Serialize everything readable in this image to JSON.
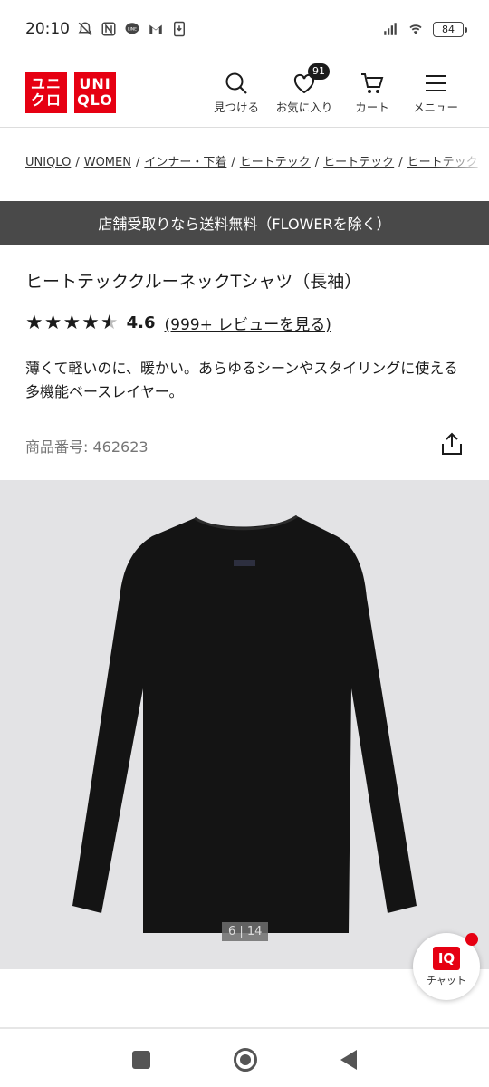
{
  "status_bar": {
    "time": "20:10",
    "battery": "84",
    "left_icons": [
      "mute-bell-icon",
      "nfc-icon",
      "line-icon",
      "gmail-icon",
      "download-icon"
    ],
    "right_icons": [
      "signal-icon",
      "wifi-icon"
    ]
  },
  "header": {
    "logo_left": [
      "ユニ",
      "クロ"
    ],
    "logo_right": [
      "UNI",
      "QLO"
    ],
    "nav": {
      "search": "見つける",
      "favorites": "お気に入り",
      "favorites_count": "91",
      "cart": "カート",
      "menu": "メニュー"
    }
  },
  "breadcrumb": [
    "UNIQLO",
    "WOMEN",
    "インナー・下着",
    "ヒートテック",
    "ヒートテック",
    "ヒートテック"
  ],
  "promo": "店舗受取りなら送料無料（FLOWERを除く）",
  "product": {
    "title": "ヒートテッククルーネックTシャツ（長袖）",
    "rating": "4.6",
    "rating_fraction": 0.92,
    "review_link": "(999+ レビューを見る)",
    "description": "薄くて軽いのに、暖かい。あらゆるシーンやスタイリングに使える多機能ベースレイヤー。",
    "code_label": "商品番号:",
    "code": "462623"
  },
  "image": {
    "counter": "6 | 14",
    "background": "#e3e3e5",
    "shirt_color": "#141414"
  },
  "chat": {
    "logo": "IQ",
    "label": "チャット"
  },
  "colors": {
    "brand": "#e60012",
    "banner": "#494949"
  }
}
